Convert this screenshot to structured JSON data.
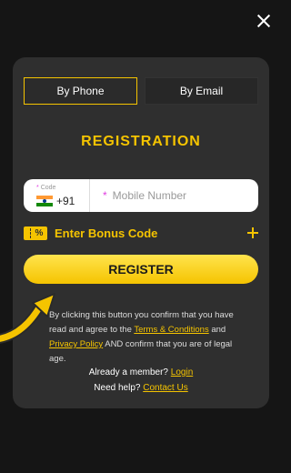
{
  "close": {
    "icon": "close-icon"
  },
  "tabs": [
    {
      "label": "By Phone",
      "active": true
    },
    {
      "label": "By Email",
      "active": false
    }
  ],
  "title": "REGISTRATION",
  "phone": {
    "code_label": "Code",
    "required_mark": "*",
    "dial_code": "+91",
    "flag_icon": "india-flag-icon",
    "placeholder": "Mobile Number"
  },
  "bonus": {
    "label": "Enter Bonus Code",
    "icon_text": "%"
  },
  "register_label": "REGISTER",
  "terms": {
    "part1": "By clicking this button you confirm that you have read and agree to the ",
    "link1": "Terms & Conditions",
    "part2": " and ",
    "link2": "Privacy Policy",
    "part3": " AND confirm that you are of legal age."
  },
  "member": {
    "text": "Already a member? ",
    "link": "Login"
  },
  "help": {
    "text": "Need help? ",
    "link": "Contact Us"
  },
  "colors": {
    "accent": "#f5c400",
    "card": "#2f2f2f",
    "background": "#151515",
    "required": "#e040e0"
  }
}
